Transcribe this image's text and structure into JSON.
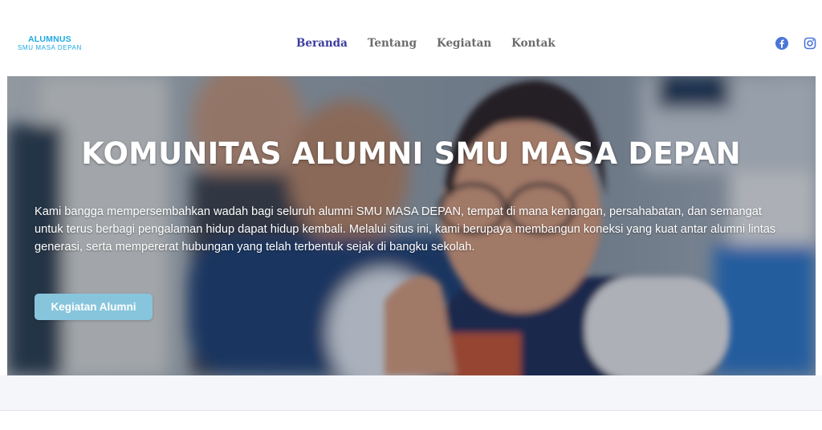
{
  "brand": {
    "name": "ALUMNUS",
    "subtitle": "SMU MASA DEPAN",
    "color": "#1fa9e1"
  },
  "nav": {
    "items": [
      {
        "label": "Beranda",
        "active": true
      },
      {
        "label": "Tentang",
        "active": false
      },
      {
        "label": "Kegiatan",
        "active": false
      },
      {
        "label": "Kontak",
        "active": false
      }
    ],
    "active_color": "#3b3c9e",
    "color": "#6b6b6b"
  },
  "social": {
    "icons": [
      "facebook-icon",
      "instagram-icon"
    ],
    "color": "#4a76d8"
  },
  "hero": {
    "title": "KOMUNITAS ALUMNI SMU MASA DEPAN",
    "description": "Kami bangga mempersembahkan wadah bagi seluruh alumni SMU MASA DEPAN, tempat di mana kenangan, persahabatan, dan semangat untuk terus berbagi pengalaman hidup dapat hidup kembali. Melalui situs ini, kami berupaya membangun koneksi yang kuat antar alumni lintas generasi, serta mempererat hubungan yang telah terbentuk sejak di bangku sekolah.",
    "button_label": "Kegiatan Alumni",
    "button_color": "#87c5dc"
  }
}
